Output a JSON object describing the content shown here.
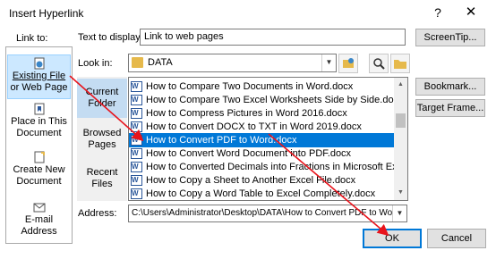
{
  "window": {
    "title": "Insert Hyperlink",
    "help_glyph": "?",
    "close_glyph": "✕"
  },
  "link_to": {
    "label": "Link to:",
    "items": [
      {
        "line1": "Existing File",
        "line2": "or Web Page",
        "selected": true,
        "icon": "globe-page-icon"
      },
      {
        "line1": "Place in This",
        "line2": "Document",
        "selected": false,
        "icon": "bookmark-page-icon"
      },
      {
        "line1": "Create New",
        "line2": "Document",
        "selected": false,
        "icon": "new-document-icon"
      },
      {
        "line1": "E-mail",
        "line2": "Address",
        "selected": false,
        "icon": "mail-icon"
      }
    ]
  },
  "text_to_display": {
    "label": "Text to display:",
    "value": "Link to web pages",
    "screentip_button": "ScreenTip..."
  },
  "look_in": {
    "label": "Look in:",
    "value": "DATA",
    "tools": [
      "web-browse-icon",
      "folder-up-icon",
      "search-web-icon",
      "browse-file-icon"
    ]
  },
  "nav": {
    "current_folder": {
      "line1": "Current",
      "line2": "Folder"
    },
    "browsed_pages": {
      "line1": "Browsed",
      "line2": "Pages"
    },
    "recent_files": {
      "line1": "Recent",
      "line2": "Files"
    }
  },
  "files": [
    "How to Compare Two Documents in Word.docx",
    "How to Compare Two Excel Worksheets Side by Side.docx",
    "How to Compress Pictures in Word 2016.docx",
    "How to Convert DOCX to TXT in Word 2019.docx",
    "How to Convert PDF to Word.docx",
    "How to Convert Word Document into PDF.docx",
    "How to Converted Decimals into Fractions in Microsoft Excel.docx",
    "How to Copy a Sheet to Another Excel File.docx",
    "How to Copy a Word Table to Excel Completely.docx"
  ],
  "selected_file_index": 4,
  "right_buttons": {
    "bookmark": "Bookmark...",
    "target_frame": "Target Frame..."
  },
  "address": {
    "label": "Address:",
    "value": "C:\\Users\\Administrator\\Desktop\\DATA\\How to Convert PDF to Word.docx"
  },
  "footer": {
    "ok": "OK",
    "cancel": "Cancel"
  },
  "colors": {
    "selection": "#0078d7",
    "annotation_arrow": "#e8141c"
  }
}
